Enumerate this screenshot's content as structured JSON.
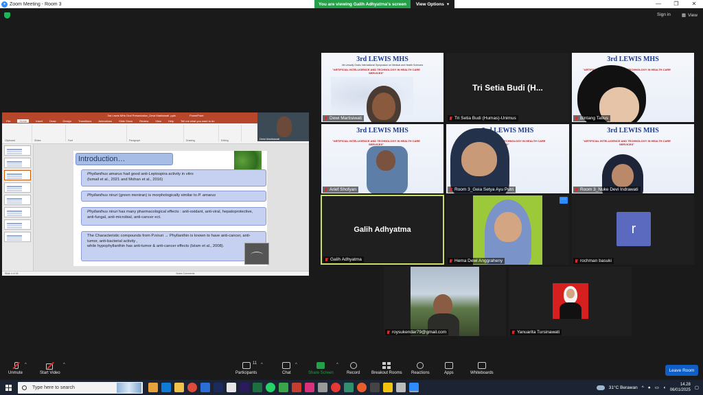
{
  "window": {
    "title": "Zoom Meeting - Room 3",
    "minimize": "—",
    "restore": "❐",
    "close": "✕"
  },
  "viewing_banner": {
    "message": "You are viewing Galih Adhyatma's screen",
    "options_label": "View Options",
    "caret": "▾"
  },
  "top_right": {
    "signin": "Sign in",
    "view": "View"
  },
  "shared_screen": {
    "ppt_title": "3rd Lewis MHs Oral Presentation_Dewi Martisiwati .pptx",
    "ppt_app": "PowerPoint",
    "tell_me": "Tell me what you want to do",
    "menu": [
      "File",
      "Home",
      "Insert",
      "Draw",
      "Design",
      "Transitions",
      "Animations",
      "Slide Show",
      "Review",
      "View",
      "Help"
    ],
    "ribbon_groups": [
      "Clipboard",
      "Slides",
      "Font",
      "Paragraph",
      "Drawing",
      "Editing"
    ],
    "presenter_label": "Dewi Martisiwati",
    "slide": {
      "heading": "Introduction…",
      "b1_line1_italic": "Phyllanthus amarus",
      "b1_line1_rest": " had good anti-Leptospira activity in vitro",
      "b1_line2": "(Ismail et al., 2021 and Mohan et al., 2016)",
      "b2_italic": "Phyllanthus niruri",
      "b2_rest": " (green meniran) is morphologically similar to ",
      "b2_italic2": "P. amarus",
      "b3_italic": "Phyllanthus niruri",
      "b3_rest": " has many pharmacological effects : anti-oxidant, anti-viral, hepatoprotective, anti-fungal, anti-microbial, anti-cancer ect.",
      "b4_line1": "The Characteristic compounds from P.niruri → Phyllanthin is known to have anti-cancer, anti-tumor, anti-bacterial activity ,",
      "b4_line2": "while hypophyllanthin has anti-tumor & anti-cancer effects (Islam et al., 2008)."
    },
    "status_left": "Slide 4 of 18",
    "status_right": "Notes  Comments"
  },
  "banner": {
    "title": "3rd LEWIS MHS",
    "subtitle": "4th Lewaily Grabs International Symposium on Medical and Health Sciences",
    "theme": "\"ARTIFICIAL INTELLIGENCE AND TECHNOLOGY IN HEALTH CARE SERVICES\""
  },
  "participants_tiles": [
    {
      "name": "Dewi Martisiwati",
      "muted": true
    },
    {
      "name": "Tri Setia Budi (Humas)-Unimus",
      "display": "Tri Setia Budi (H...",
      "muted": true
    },
    {
      "name": "Bintang Tatius",
      "muted": true
    },
    {
      "name": "Arief Shofyan",
      "muted": true
    },
    {
      "name": "Room 3_Geia Setya Ayu Putri",
      "muted": true
    },
    {
      "name": "Room 3_Nuke Devi Indrawati",
      "muted": true
    },
    {
      "name": "Galih Adhyatma",
      "display": "Galih Adhyatma",
      "muted": true
    },
    {
      "name": "Hema Dewi Anggraheny",
      "muted": true
    },
    {
      "name": "rochman basuki",
      "avatar_letter": "r",
      "muted": true
    },
    {
      "name": "roysukendar79@gmail.com",
      "muted": true
    },
    {
      "name": "Yanuarita Tursinawati",
      "muted": true
    }
  ],
  "toolbar": {
    "unmute": "Unmute",
    "start_video": "Start Video",
    "participants": "Participants",
    "participants_count": "11",
    "chat": "Chat",
    "share_screen": "Share Screen",
    "record": "Record",
    "breakout_rooms": "Breakout Rooms",
    "reactions": "Reactions",
    "apps": "Apps",
    "whiteboards": "Whiteboards",
    "leave": "Leave Room",
    "caret": "^"
  },
  "taskbar": {
    "search_placeholder": "Type here to search",
    "weather": "31°C  Berawan",
    "time": "14.28",
    "date": "06/01/2025"
  },
  "colors": {
    "zoom_blue": "#2d8cff",
    "green_banner": "#24a148",
    "leave_button": "#0e5ec6",
    "active_speaker_border": "#c8e06a",
    "ppt_red": "#b7472a"
  }
}
